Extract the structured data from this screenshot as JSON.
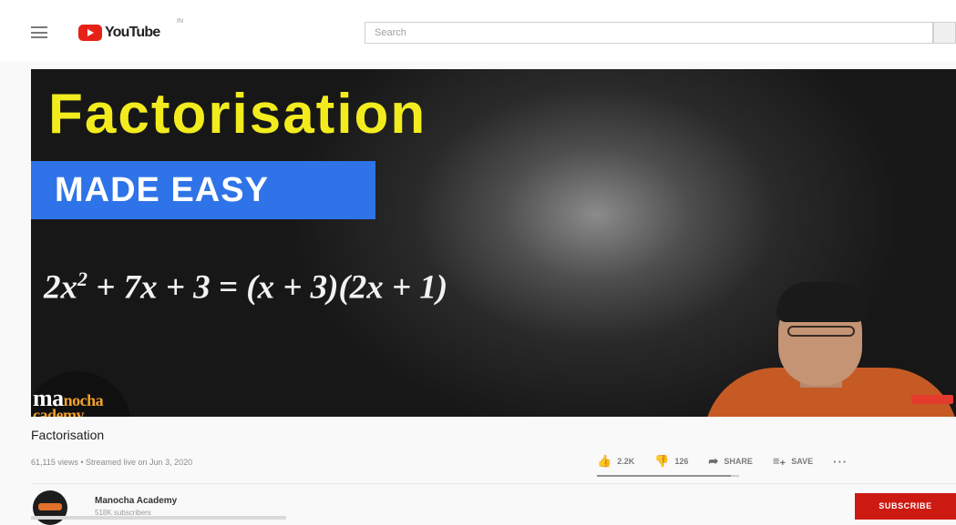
{
  "header": {
    "logo_text": "YouTube",
    "logo_region": "IN",
    "search_placeholder": "Search"
  },
  "thumbnail": {
    "title": "Factorisation",
    "badge": "MADE EASY",
    "equation": {
      "pre": "2x",
      "sup": "2",
      "post": " + 7x + 3 = (x + 3)(2x + 1)"
    },
    "channel_logo": {
      "line1_a": "ma",
      "line1_b": "nocha",
      "line2": "cademy"
    }
  },
  "video": {
    "title": "Factorisation",
    "meta": "61,115 views • Streamed live on Jun 3, 2020"
  },
  "actions": {
    "likes": "2.2K",
    "dislikes": "126",
    "share": "SHARE",
    "save": "SAVE",
    "more": "···",
    "like_ratio": 0.94
  },
  "owner": {
    "name": "Manocha Academy",
    "subscribers": "518K subscribers",
    "subscribe": "SUBSCRIBE"
  },
  "colors": {
    "brand_red": "#e62117",
    "subscribe_red": "#cc1a12",
    "thumbnail_yellow": "#f2ec1f",
    "thumbnail_blue": "#2f73e8"
  }
}
